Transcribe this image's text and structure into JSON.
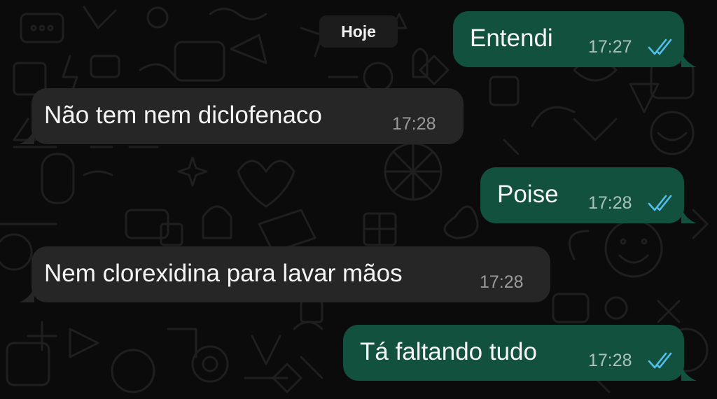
{
  "chat": {
    "date_label": "Hoje",
    "messages": [
      {
        "direction": "outgoing",
        "text": "Entendi",
        "time": "17:27",
        "status": "read"
      },
      {
        "direction": "incoming",
        "text": "Não tem nem diclofenaco",
        "time": "17:28"
      },
      {
        "direction": "outgoing",
        "text": "Poise",
        "time": "17:28",
        "status": "read"
      },
      {
        "direction": "incoming",
        "text": "Nem clorexidina para lavar mãos",
        "time": "17:28"
      },
      {
        "direction": "outgoing",
        "text": "Tá faltando tudo",
        "time": "17:28",
        "status": "read"
      }
    ]
  },
  "colors": {
    "background": "#0b0b0b",
    "outgoing_bubble": "#13513f",
    "incoming_bubble": "#262627",
    "read_ticks": "#53bdeb",
    "date_pill": "#1c1c1c"
  },
  "icons": {
    "read_receipt": "double-check-icon"
  }
}
